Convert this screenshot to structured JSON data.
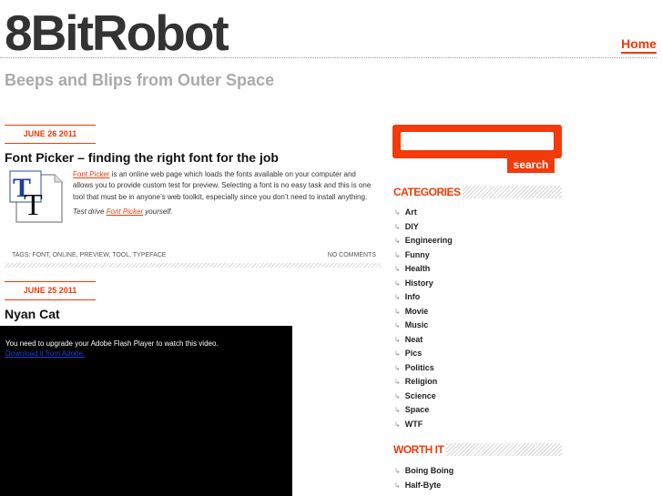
{
  "site": {
    "title": "8BitRobot",
    "tagline": "Beeps and Blips from Outer Space",
    "nav_home": "Home"
  },
  "posts": [
    {
      "date": "JUNE 26 2011",
      "title": "Font Picker – finding the right font for the job",
      "link_text": "Font Picker",
      "body": " is an online web page which loads the fonts available on your computer and allows you to provide custom test for preview. Selecting a font is no easy task and this is one tool that must be in anyone’s web toolkit, especially since you don’t need to install anything.",
      "try_prefix": "Test drive ",
      "try_link": "Font Picker",
      "try_suffix": " yourself.",
      "icon": "font-tt-icon",
      "tags": "TAGS: FONT, ONLINE, PREVIEW, TOOL, TYPEFACE",
      "comments": "NO COMMENTS"
    },
    {
      "date": "JUNE 25 2011",
      "title": "Nyan Cat",
      "video_message": "You need to upgrade your Adobe Flash Player to watch this video.",
      "video_link": "Download it from Adobe."
    }
  ],
  "sidebar": {
    "search_button": "search",
    "search_value": "",
    "categories_heading": "CATEGORIES",
    "categories": [
      "Art",
      "DIY",
      "Engineering",
      "Funny",
      "Health",
      "History",
      "Info",
      "Movie",
      "Music",
      "Neat",
      "Pics",
      "Politics",
      "Religion",
      "Science",
      "Space",
      "WTF"
    ],
    "worth_heading": "WORTH IT",
    "worth_links": [
      "Boing Boing",
      "Half-Byte"
    ]
  },
  "colors": {
    "accent": "#f23a0a",
    "title": "#333333",
    "tagline": "#aaaaaa"
  }
}
